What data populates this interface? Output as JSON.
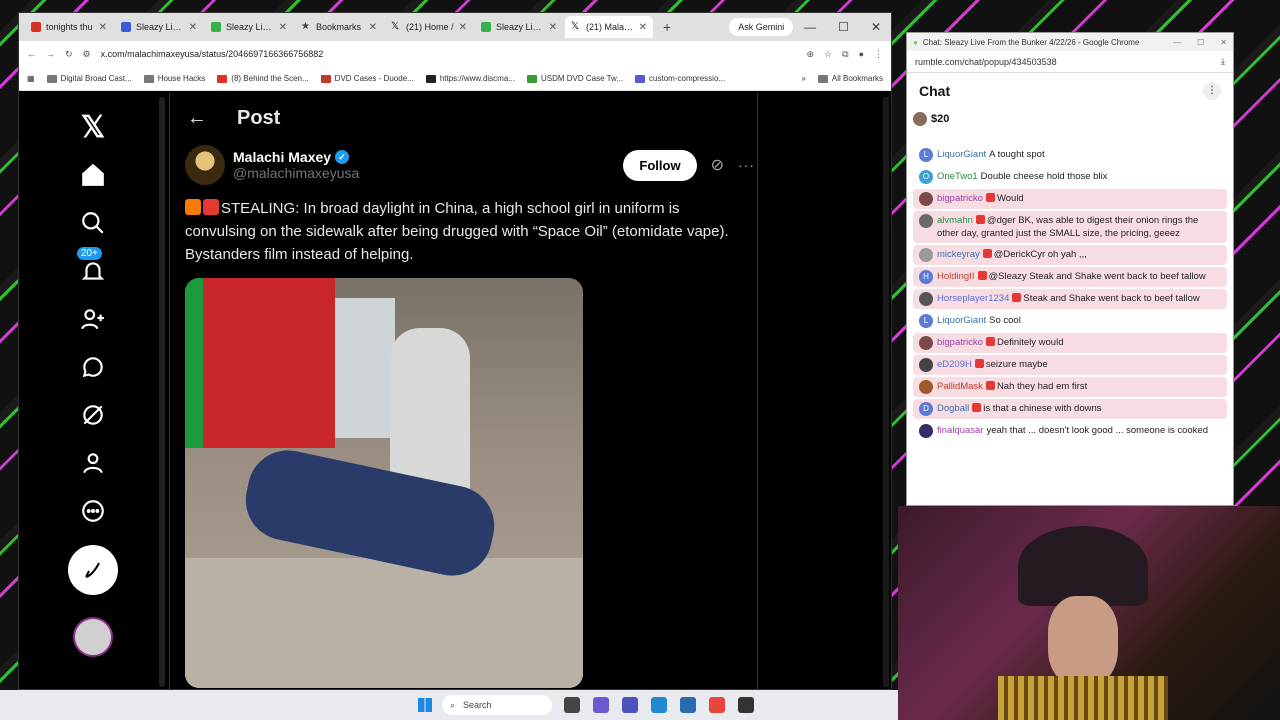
{
  "browser": {
    "tabs": [
      {
        "label": "tonights thu",
        "color": "#d93025"
      },
      {
        "label": "Sleazy Live F",
        "color": "#3a5bd9"
      },
      {
        "label": "Sleazy Live F",
        "color": "#35b34a"
      },
      {
        "label": "Bookmarks",
        "color": "#444444"
      },
      {
        "label": "(21) Home /",
        "color": "#000000"
      },
      {
        "label": "Sleazy Live F",
        "color": "#35b34a"
      },
      {
        "label": "(21) Malachi",
        "color": "#000000"
      }
    ],
    "ask_gemini": "Ask Gemini",
    "url": "x.com/malachimaxeyusa/status/2046697166366756882",
    "bookmarks": [
      "Digital Broad Cast...",
      "House Hacks",
      "(8) Behind the Scen...",
      "DVD Cases - Duode...",
      "https://www.discma...",
      "USDM DVD Case Tw...",
      "custom-compressio..."
    ],
    "all_bookmarks": "All Bookmarks"
  },
  "x": {
    "notif_badge": "20+",
    "header_title": "Post",
    "author_name": "Malachi Maxey",
    "author_handle": "@malachimaxeyusa",
    "follow_label": "Follow",
    "post_text": "STEALING:  In broad daylight in China, a high school girl in uniform is convulsing on the sidewalk after being drugged with “Space Oil” (etomidate vape). Bystanders film instead of helping."
  },
  "chat": {
    "window_title": "Chat: Sleazy Live From the Bunker 4/22/26 - Google Chrome",
    "url": "rumble.com/chat/popup/434503538",
    "title": "Chat",
    "rant": "$20",
    "messages": [
      {
        "user": "LiquorGiant",
        "text": "A tought spot",
        "user_color": "#3a6fb0",
        "avatar": "L",
        "avatar_color": "#5b7bd5",
        "pink": false
      },
      {
        "user": "OneTwo1",
        "text": "Double cheese hold those blix",
        "user_color": "#2c8a4a",
        "avatar": "O",
        "avatar_color": "#3aa0d5",
        "pink": false
      },
      {
        "user": "bigpatricko",
        "text": "Would",
        "user_color": "#9b3fa8",
        "avatar": "",
        "avatar_color": "#7a4a4a",
        "pink": true
      },
      {
        "user": "alvmahn",
        "text": "@dger BK, was able to digest their onion rings the other day, granted just the SMALL size, the pricing, geeez",
        "user_color": "#2c8a4a",
        "avatar": "",
        "avatar_color": "#6a6a6a",
        "pink": true
      },
      {
        "user": "mickeyray",
        "text": "@DerickCyr oh yah ,,,",
        "user_color": "#3a6fb0",
        "avatar": "",
        "avatar_color": "#999999",
        "pink": true
      },
      {
        "user": "HoldingII",
        "text": "@Sleazy Steak and Shake went back to beef tallow",
        "user_color": "#c0392b",
        "avatar": "H",
        "avatar_color": "#5b7bd5",
        "pink": true
      },
      {
        "user": "Horseplayer1234",
        "text": "Steak and Shake went back to beef tallow",
        "user_color": "#5b6fd5",
        "avatar": "",
        "avatar_color": "#555555",
        "pink": true
      },
      {
        "user": "LiquorGiant",
        "text": "So cool",
        "user_color": "#3a6fb0",
        "avatar": "L",
        "avatar_color": "#5b7bd5",
        "pink": false
      },
      {
        "user": "bigpatricko",
        "text": "Definitely would",
        "user_color": "#9b3fa8",
        "avatar": "",
        "avatar_color": "#7a4a4a",
        "pink": true
      },
      {
        "user": "eD209H",
        "text": "seizure maybe",
        "user_color": "#5b6fd5",
        "avatar": "",
        "avatar_color": "#444444",
        "pink": true
      },
      {
        "user": "PallidMask",
        "text": "Nah they had em first",
        "user_color": "#c0392b",
        "avatar": "",
        "avatar_color": "#a05a2a",
        "pink": true
      },
      {
        "user": "Dogball",
        "text": "is that a chinese with downs",
        "user_color": "#3a6fb0",
        "avatar": "D",
        "avatar_color": "#5b7bd5",
        "pink": true
      },
      {
        "user": "finalquasar",
        "text": "yeah that ... doesn't look good ... someone is cooked",
        "user_color": "#9b3fa8",
        "avatar": "",
        "avatar_color": "#3a2a6a",
        "pink": false
      }
    ]
  },
  "taskbar": {
    "search_label": "Search"
  }
}
